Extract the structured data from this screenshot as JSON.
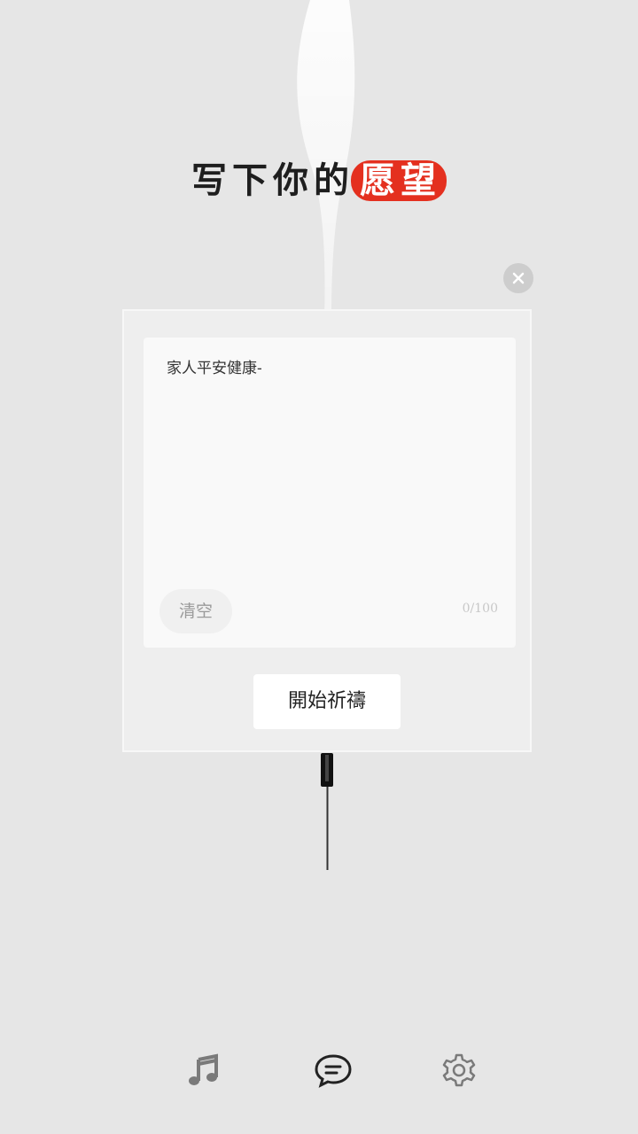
{
  "header": {
    "title_prefix": "写下你的",
    "title_highlight": "愿望"
  },
  "wish_form": {
    "text_value": "家人平安健康-",
    "clear_label": "清空",
    "char_counter": "0/100",
    "submit_label": "開始祈禱"
  },
  "bottom_nav": {
    "items": [
      {
        "icon": "music-note-icon"
      },
      {
        "icon": "chat-icon"
      },
      {
        "icon": "gear-icon"
      }
    ]
  },
  "colors": {
    "background": "#e6e6e6",
    "highlight": "#e4301f",
    "card": "#eeeeee"
  }
}
